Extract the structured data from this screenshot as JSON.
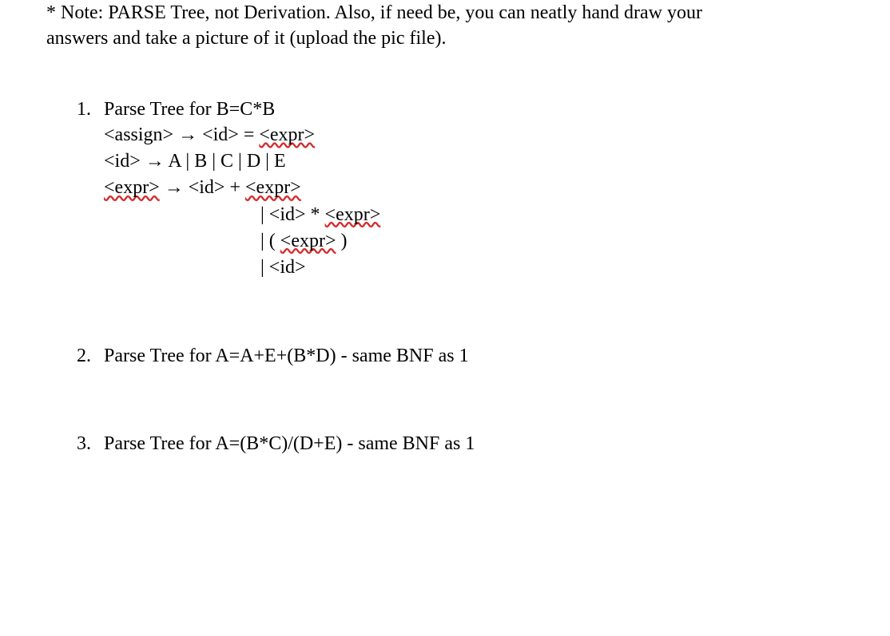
{
  "note": {
    "line1": "* Note: PARSE Tree, not Derivation.  Also, if need be, you can neatly hand draw your",
    "line2": "answers and take a picture of it (upload the pic file)."
  },
  "q1": {
    "num": "1.",
    "title": "Parse Tree for B=C*B",
    "grammar": {
      "assign_lhs": "<assign>",
      "arrow": " → ",
      "assign_rhs_pre": "<id> = ",
      "expr_token": "<expr>",
      "id_line": "<id> → A | B | C | D | E",
      "expr_lhs": "<expr>",
      "expr_arrow": " → ",
      "expr_rhs1_pre": "<id> + ",
      "expr_alt2_pre": "| <id> * ",
      "expr_alt3_pre": "| ( ",
      "expr_alt3_post": " )",
      "expr_alt4": "| <id>"
    }
  },
  "q2": {
    "num": "2.",
    "title": "Parse Tree for A=A+E+(B*D)   - same BNF as 1"
  },
  "q3": {
    "num": "3.",
    "title": "Parse Tree for A=(B*C)/(D+E)     - same BNF as 1"
  }
}
